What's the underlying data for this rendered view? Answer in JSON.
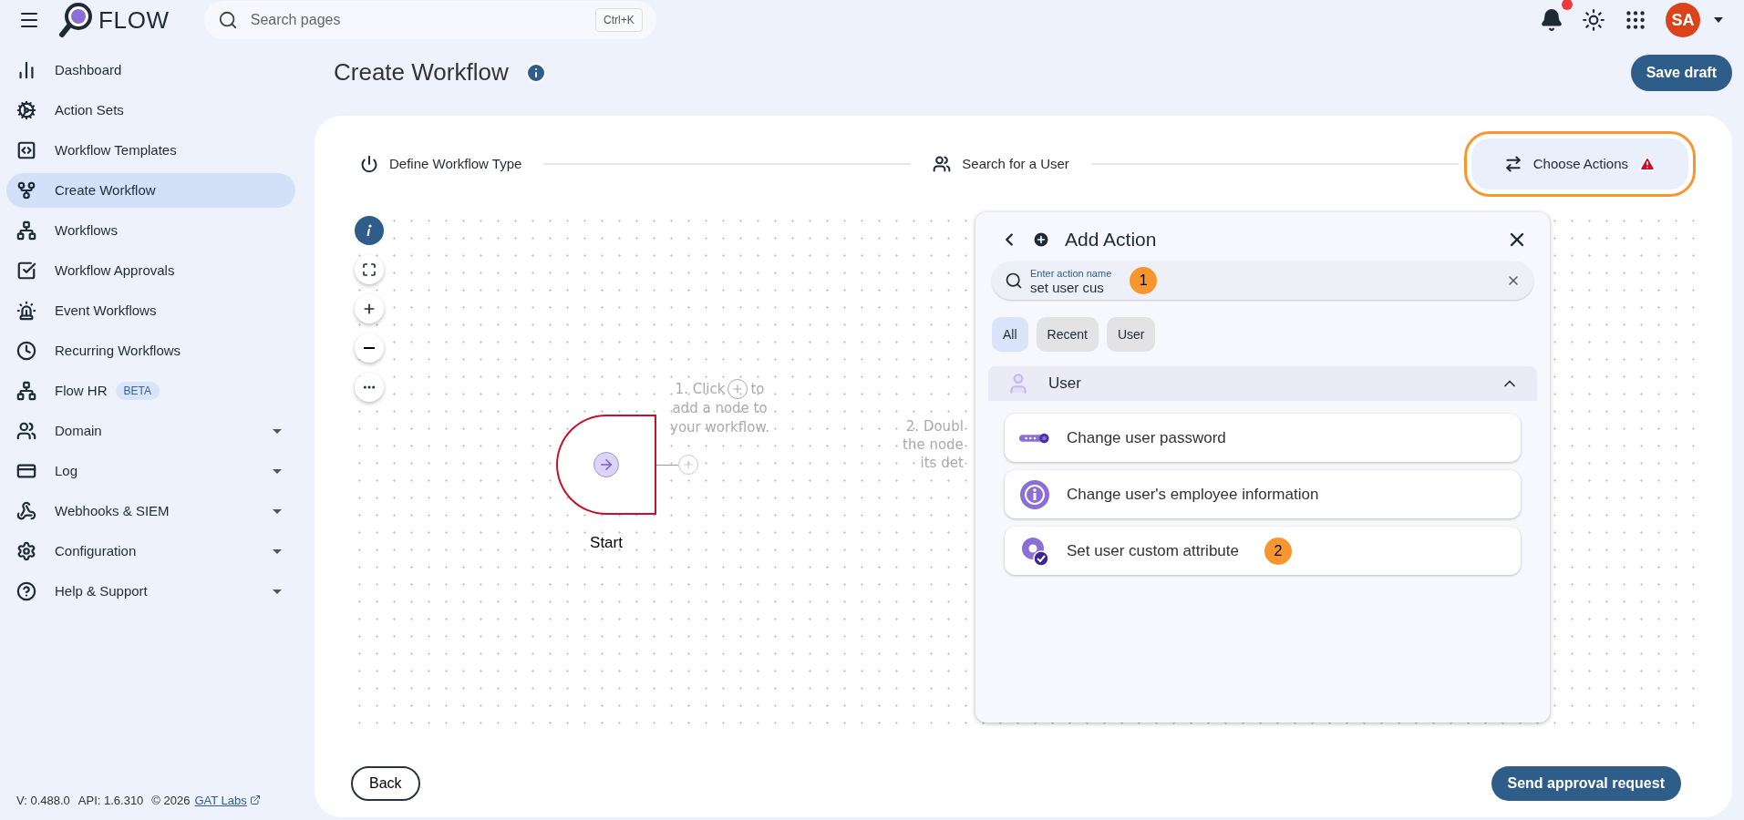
{
  "header": {
    "app_name": "FLOW",
    "search": {
      "placeholder": "Search pages",
      "shortcut": "Ctrl+K"
    },
    "notifications_unread": true,
    "avatar_initials": "SA"
  },
  "sidebar": {
    "items": [
      {
        "label": "Dashboard",
        "selected": false,
        "expandable": false
      },
      {
        "label": "Action Sets",
        "selected": false,
        "expandable": false
      },
      {
        "label": "Workflow Templates",
        "selected": false,
        "expandable": false
      },
      {
        "label": "Create Workflow",
        "selected": true,
        "expandable": false
      },
      {
        "label": "Workflows",
        "selected": false,
        "expandable": false
      },
      {
        "label": "Workflow Approvals",
        "selected": false,
        "expandable": false
      },
      {
        "label": "Event Workflows",
        "selected": false,
        "expandable": false
      },
      {
        "label": "Recurring Workflows",
        "selected": false,
        "expandable": false
      },
      {
        "label": "Flow HR",
        "selected": false,
        "expandable": false,
        "badge": "BETA"
      },
      {
        "label": "Domain",
        "selected": false,
        "expandable": true
      },
      {
        "label": "Log",
        "selected": false,
        "expandable": true
      },
      {
        "label": "Webhooks & SIEM",
        "selected": false,
        "expandable": true
      },
      {
        "label": "Configuration",
        "selected": false,
        "expandable": true
      },
      {
        "label": "Help & Support",
        "selected": false,
        "expandable": true
      }
    ],
    "footer": {
      "version": "V: 0.488.0",
      "api": "API: 1.6.310",
      "copyright": "© 2026",
      "link": "GAT Labs"
    }
  },
  "page": {
    "title": "Create Workflow",
    "save_button": "Save draft"
  },
  "stepper": [
    {
      "label": "Define Workflow Type",
      "selected": false,
      "warning": false,
      "highlighted": false
    },
    {
      "label": "Search for a User",
      "selected": false,
      "warning": false,
      "highlighted": false
    },
    {
      "label": "Choose Actions",
      "selected": true,
      "warning": true,
      "highlighted": true
    }
  ],
  "canvas": {
    "start_node": "Start",
    "hint_1": {
      "before": "1. Click",
      "after": "to",
      "lines": [
        "add a node to",
        "your workflow."
      ]
    },
    "hint_2": [
      "2. Doubl",
      "the node",
      "its det"
    ]
  },
  "add_action": {
    "title": "Add Action",
    "search": {
      "label": "Enter action name",
      "value": "set user cus",
      "annotation": "1"
    },
    "filters": [
      {
        "label": "All",
        "selected": true
      },
      {
        "label": "Recent",
        "selected": false
      },
      {
        "label": "User",
        "selected": false
      }
    ],
    "group": {
      "label": "User",
      "expanded": true,
      "actions": [
        {
          "label": "Change user password"
        },
        {
          "label": "Change user's employee information"
        },
        {
          "label": "Set user custom attribute",
          "annotation": "2"
        }
      ]
    }
  },
  "footer": {
    "back": "Back",
    "send": "Send approval request"
  }
}
